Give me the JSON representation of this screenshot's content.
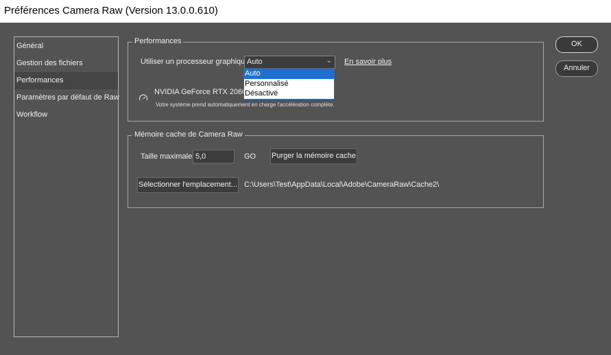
{
  "window": {
    "title": "Préférences Camera Raw  (Version 13.0.0.610)"
  },
  "sidebar": {
    "items": [
      {
        "label": "Général"
      },
      {
        "label": "Gestion des fichiers"
      },
      {
        "label": "Performances"
      },
      {
        "label": "Paramètres par défaut de Raw"
      },
      {
        "label": "Workflow"
      }
    ],
    "selected": "Performances"
  },
  "performances": {
    "title": "Performances",
    "gpu_label": "Utiliser un processeur graphique :",
    "gpu_select_value": "Auto",
    "learn_more": "En savoir plus",
    "dropdown_options": [
      "Auto",
      "Personnalisé",
      "Désactivé"
    ],
    "dropdown_selected": "Auto",
    "gpu_name": "NVIDIA GeForce RTX 2060 (26",
    "gpu_note": "Votre système prend automatiquement en charge l'accélération complète."
  },
  "cache": {
    "title": "Mémoire cache de Camera Raw",
    "size_label": "Taille maximale :",
    "size_value": "5,0",
    "size_unit": "GO",
    "purge_label": "Purger la mémoire cache",
    "location_button": "Sélectionner l'emplacement...",
    "location_path": "C:\\Users\\Test\\AppData\\Local\\Adobe\\CameraRaw\\Cache2\\"
  },
  "actions": {
    "ok": "OK",
    "cancel": "Annuler"
  },
  "icons": {
    "gpu": "speedometer-icon",
    "chevron": "chevron-down-icon"
  },
  "colors": {
    "background": "#535353",
    "selection": "#1e6fd0",
    "active_item": "#454545"
  }
}
